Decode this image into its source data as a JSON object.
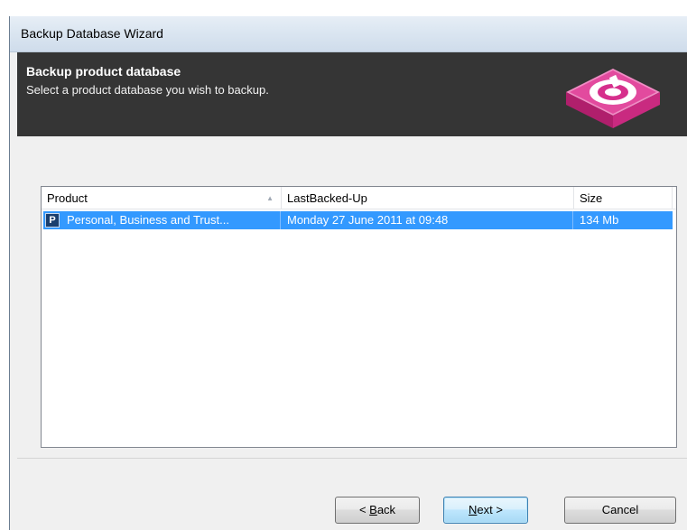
{
  "window": {
    "title": "Backup Database Wizard"
  },
  "header": {
    "title": "Backup product database",
    "subtitle": "Select a product database you wish to backup."
  },
  "list": {
    "columns": [
      "Product",
      "LastBacked-Up",
      "Size"
    ],
    "rows": [
      {
        "icon_letter": "P",
        "product": "Personal, Business and Trust...",
        "last_backed_up": "Monday 27 June 2011 at 09:48",
        "size": "134 Mb",
        "selected": true
      }
    ]
  },
  "buttons": {
    "back_prefix": "< ",
    "back_mnemonic": "B",
    "back_rest": "ack",
    "next_mnemonic": "N",
    "next_rest": "ext >",
    "cancel": "Cancel"
  },
  "colors": {
    "header_band": "#353535",
    "selection": "#3399ff",
    "logo_pink": "#d62f8c"
  }
}
